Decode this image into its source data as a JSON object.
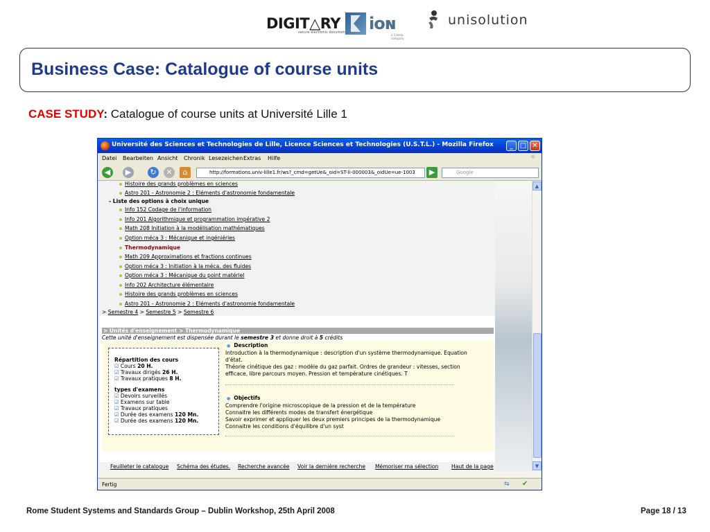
{
  "logos": {
    "digitary": "DIGIT△RY",
    "digitary_tagline": "secure electronic documents",
    "kion": "ioɴ",
    "kion_tagline": "a Cineca company",
    "unisolution": "unisolution"
  },
  "slide": {
    "title": "Business Case: Catalogue of course units",
    "case_tag": "CASE STUDY",
    "case_colon": ":",
    "case_text": " Catalogue of course units at Université Lille 1",
    "footer_left": "Rome Student Systems and Standards Group – Dublin Workshop, 25th April 2008",
    "footer_right": "Page 18 / 13"
  },
  "browser": {
    "window_title": "Université des Sciences et Technologies de Lille, Licence Sciences et Technologies (U.S.T.L.) - Mozilla Firefox",
    "menu": [
      "Datei",
      "Bearbeiten",
      "Ansicht",
      "Chronik",
      "Lesezeichen",
      "Extras",
      "Hilfe"
    ],
    "url": "http://formations.univ-lille1.fr/ws?_cmd=getUe&_oid=ST-li-000003&_oidUe=ue-1003",
    "search_placeholder": "Google",
    "status": "Fertig"
  },
  "page": {
    "top_items": [
      "Histoire des grands problèmes en sciences",
      "Astro 201 - Astronomie 2 : Eléments d'astronomie fondamentale"
    ],
    "options_heading": "Liste des options à choix unique",
    "options": [
      "Info 152 Codage de l'information",
      "Info 201 Algorithmique et programmation impérative 2",
      "Math 208 Initiation à la modélisation mathématiques",
      "Option méca 3 : Mécanique et ingéniéries",
      "Thermodynamique",
      "Math 209 Approximations et fractions continues",
      "Option méca 3 : Initiation à la méca. des fluides",
      "Option méca 3 : Mécanique du point matériel",
      "Info 202 Architecture élémentaire",
      "Histoire des grands problèmes en sciences",
      "Astro 201 - Astronomie 2 : Eléments d'astronomie fondamentale"
    ],
    "semesters_prefix": "> ",
    "semester_4": "Semestre 4",
    "semester_5": "Semestre 5",
    "semester_6": "Semestre 6",
    "section_bar": "> Unités d'enseignement > Thermodynamique",
    "ue_sentence_a": "Cette unité d'enseignement est dispensée durant le ",
    "ue_semester": "semestre 3",
    "ue_sentence_b": " et donne droit à ",
    "ue_credits": "5",
    "ue_sentence_c": " crédits",
    "repartition_title": "Répartition des cours",
    "cours_label": "Cours ",
    "cours_value": "20 H.",
    "td_label": "Travaux dirigés ",
    "td_value": "26 H.",
    "tp_label": "Travaux pratiques ",
    "tp_value": "8 H.",
    "exam_title": "types d'examens",
    "exam_types": [
      "Devoirs surveillés",
      "Examens sur table",
      "Travaux pratiques"
    ],
    "duree_label": "Durée des examens ",
    "duree_value": "120 Mn.",
    "description_heading": "Description",
    "description_lines": [
      "Introduction à la thermodynamique : description d'un système thermodynamique. Equation",
      "d'état.",
      "Théorie cinétique des gaz : modèle du gaz parfait. Ordres de grandeur : vitesses, section",
      "efficace, libre parcours moyen. Pression et température cinétiques. T"
    ],
    "objectives_heading": "Objectifs",
    "objectives_lines": [
      "Comprendre l'origine microscopique de la pression et de la température",
      "Connaitre les différents modes de transfert énergétique",
      "Savoir exprimer et appliquer les deux premiers principes de la thermodynamique",
      "Connaitre les conditions d'équilibre d'un syst"
    ],
    "footer_links": [
      "Feuilleter le catalogue",
      "Schéma des études.",
      "Recherche avancée",
      "Voir la dernière recherche",
      "Mémoriser ma sélection",
      "Haut de la page"
    ]
  }
}
